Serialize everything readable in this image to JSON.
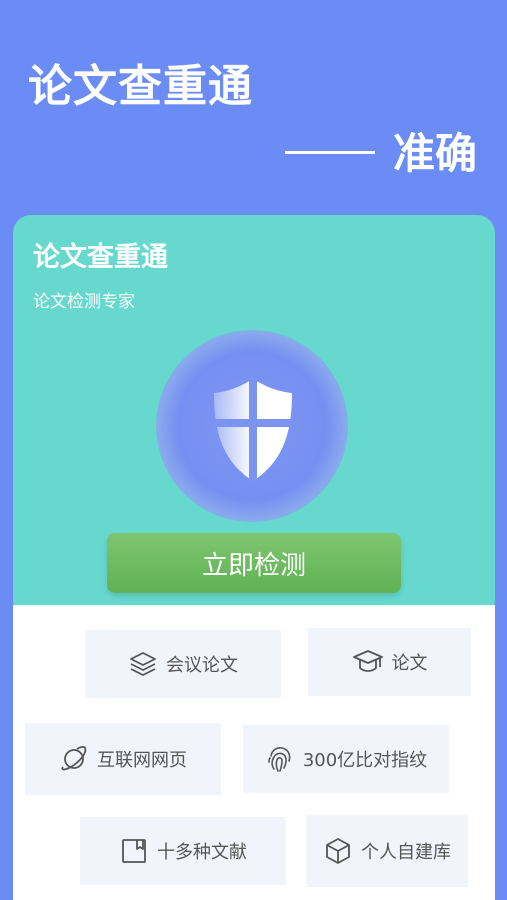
{
  "hero": {
    "title": "论文查重通",
    "subtitle": "准确"
  },
  "card": {
    "title": "论文查重通",
    "subtitle": "论文检测专家",
    "button_label": "立即检测"
  },
  "features": [
    {
      "label": "会议论文",
      "icon": "layers-icon"
    },
    {
      "label": "论文",
      "icon": "graduation-cap-icon"
    },
    {
      "label": "互联网网页",
      "icon": "planet-icon"
    },
    {
      "label": "300亿比对指纹",
      "icon": "fingerprint-icon"
    },
    {
      "label": "十多种文献",
      "icon": "document-icon"
    },
    {
      "label": "个人自建库",
      "icon": "cube-icon"
    }
  ],
  "colors": {
    "background": "#6b8cf5",
    "card": "#67d8cd",
    "button": "#6fbd63",
    "tile": "#f2f4fc",
    "text_dark": "#555555"
  }
}
